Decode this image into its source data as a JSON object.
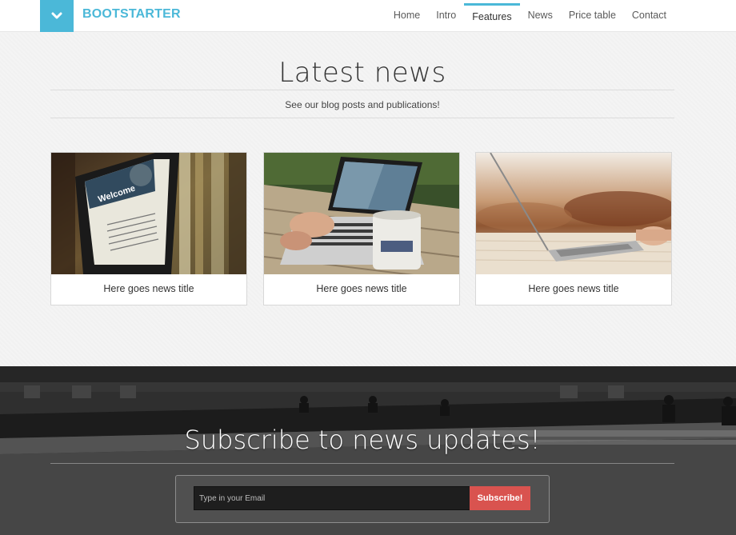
{
  "navbar": {
    "brand": "BOOTSTARTER",
    "toggle_icon": "chevron-down-icon",
    "items": [
      {
        "label": "Home",
        "active": false
      },
      {
        "label": "Intro",
        "active": false
      },
      {
        "label": "Features",
        "active": true
      },
      {
        "label": "News",
        "active": false
      },
      {
        "label": "Price table",
        "active": false
      },
      {
        "label": "Contact",
        "active": false
      }
    ]
  },
  "news": {
    "title": "Latest news",
    "subtitle": "See our blog posts and publications!",
    "cards": [
      {
        "title": "Here goes news title",
        "image": "tablet-welcome-photo"
      },
      {
        "title": "Here goes news title",
        "image": "laptop-outdoor-coffee-photo"
      },
      {
        "title": "Here goes news title",
        "image": "laptop-on-sofa-photo"
      }
    ]
  },
  "subscribe": {
    "title": "Subscribe to news updates!",
    "email_placeholder": "Type in your Email",
    "button_label": "Subscribe!"
  },
  "colors": {
    "accent": "#4bb8d8",
    "button": "#d9534f"
  }
}
